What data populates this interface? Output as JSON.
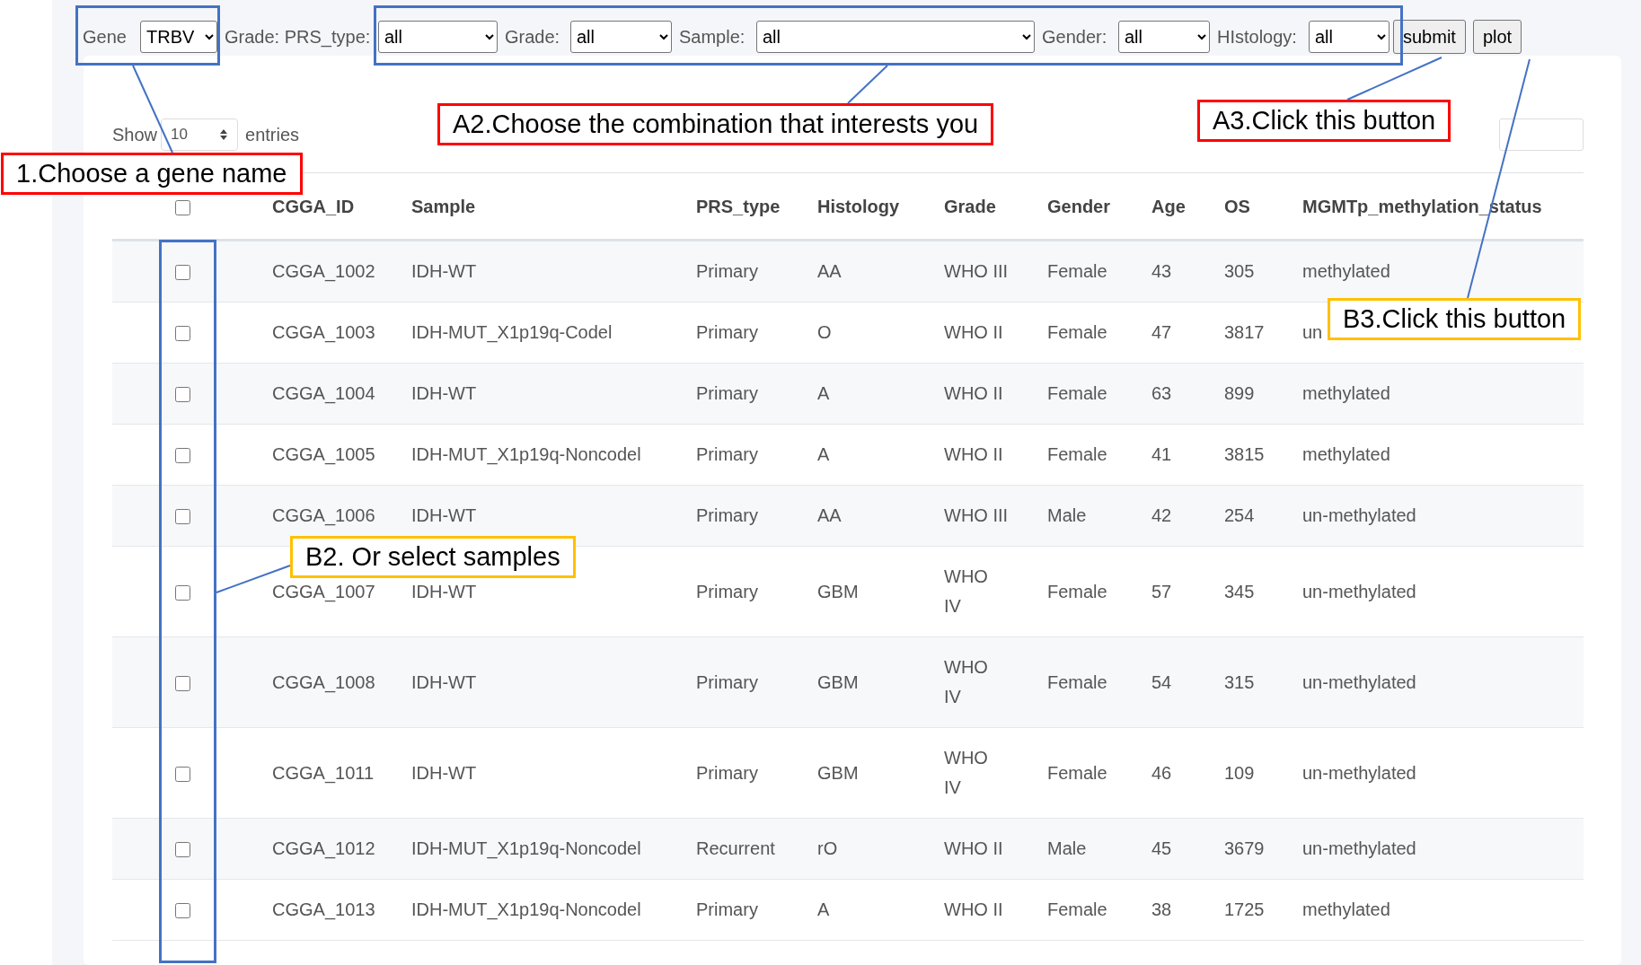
{
  "filters": [
    {
      "label": "Gene",
      "value": "TRBV"
    },
    {
      "label": "Grade: PRS_type:",
      "value": "all"
    },
    {
      "label": "Grade:",
      "value": "all"
    },
    {
      "label": "Sample:",
      "value": "all"
    },
    {
      "label": "Gender:",
      "value": "all"
    },
    {
      "label": "HIstology:",
      "value": "all"
    }
  ],
  "buttons": [
    "submit",
    "plot"
  ],
  "length_menu": {
    "label_before": "Show",
    "value": "10",
    "label_after": "entries"
  },
  "table": {
    "select_all": {
      "checked": false
    },
    "columns": [
      "CGGA_ID",
      "Sample",
      "PRS_type",
      "Histology",
      "Grade",
      "Gender",
      "Age",
      "OS",
      "MGMTp_methylation_status"
    ],
    "rows": [
      {
        "checked": false,
        "cells": [
          "CGGA_1002",
          "IDH-WT",
          "Primary",
          "AA",
          "WHO III",
          "Female",
          "43",
          "305",
          "methylated"
        ]
      },
      {
        "checked": false,
        "cells": [
          "CGGA_1003",
          "IDH-MUT_X1p19q-Codel",
          "Primary",
          "O",
          "WHO II",
          "Female",
          "47",
          "3817",
          "un"
        ]
      },
      {
        "checked": false,
        "cells": [
          "CGGA_1004",
          "IDH-WT",
          "Primary",
          "A",
          "WHO II",
          "Female",
          "63",
          "899",
          "methylated"
        ]
      },
      {
        "checked": false,
        "cells": [
          "CGGA_1005",
          "IDH-MUT_X1p19q-Noncodel",
          "Primary",
          "A",
          "WHO II",
          "Female",
          "41",
          "3815",
          "methylated"
        ]
      },
      {
        "checked": false,
        "cells": [
          "CGGA_1006",
          "IDH-WT",
          "Primary",
          "AA",
          "WHO III",
          "Male",
          "42",
          "254",
          "un-methylated"
        ]
      },
      {
        "checked": false,
        "cells": [
          "CGGA_1007",
          "IDH-WT",
          "Primary",
          "GBM",
          "WHO IV",
          "Female",
          "57",
          "345",
          "un-methylated"
        ]
      },
      {
        "checked": false,
        "cells": [
          "CGGA_1008",
          "IDH-WT",
          "Primary",
          "GBM",
          "WHO IV",
          "Female",
          "54",
          "315",
          "un-methylated"
        ]
      },
      {
        "checked": false,
        "cells": [
          "CGGA_1011",
          "IDH-WT",
          "Primary",
          "GBM",
          "WHO IV",
          "Female",
          "46",
          "109",
          "un-methylated"
        ]
      },
      {
        "checked": false,
        "cells": [
          "CGGA_1012",
          "IDH-MUT_X1p19q-Noncodel",
          "Recurrent",
          "rO",
          "WHO II",
          "Male",
          "45",
          "3679",
          "un-methylated"
        ]
      },
      {
        "checked": false,
        "cells": [
          "CGGA_1013",
          "IDH-MUT_X1p19q-Noncodel",
          "Primary",
          "A",
          "WHO II",
          "Female",
          "38",
          "1725",
          "methylated"
        ]
      }
    ]
  },
  "annotations": [
    {
      "kind": "highlight",
      "color": "#4472c4"
    },
    {
      "kind": "highlight",
      "color": "#4472c4"
    },
    {
      "kind": "callout",
      "color": "#ff0000",
      "text": "1.Choose a gene name"
    },
    {
      "kind": "callout",
      "color": "#ff0000",
      "text": "A2.Choose the combination that interests you"
    },
    {
      "kind": "callout",
      "color": "#ff0000",
      "text": "A3.Click this button"
    },
    {
      "kind": "callout",
      "color": "#ffc000",
      "text": "B3.Click this button"
    },
    {
      "kind": "highlight",
      "color": "#4472c4"
    },
    {
      "kind": "callout",
      "color": "#ffc000",
      "text": "B2. Or select samples"
    }
  ]
}
